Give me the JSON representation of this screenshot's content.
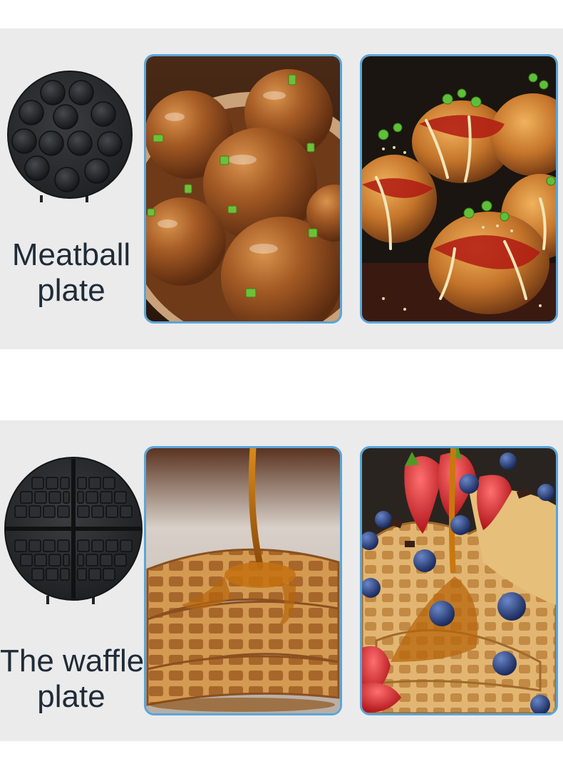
{
  "sections": [
    {
      "title_lines": [
        "Meatball",
        "plate"
      ],
      "plate_icon": "meatball-plate-icon",
      "photos": [
        "glazed-meatballs-photo",
        "takoyaki-photo"
      ]
    },
    {
      "title_lines": [
        "The waffle",
        "plate"
      ],
      "plate_icon": "waffle-plate-icon",
      "photos": [
        "syrup-waffles-photo",
        "berry-waffles-photo"
      ]
    }
  ],
  "colors": {
    "band_background": "#ebebeb",
    "photo_border": "#5aa5d9",
    "title_text": "#1f2b38",
    "plate_dark": "#2a2c2e"
  }
}
